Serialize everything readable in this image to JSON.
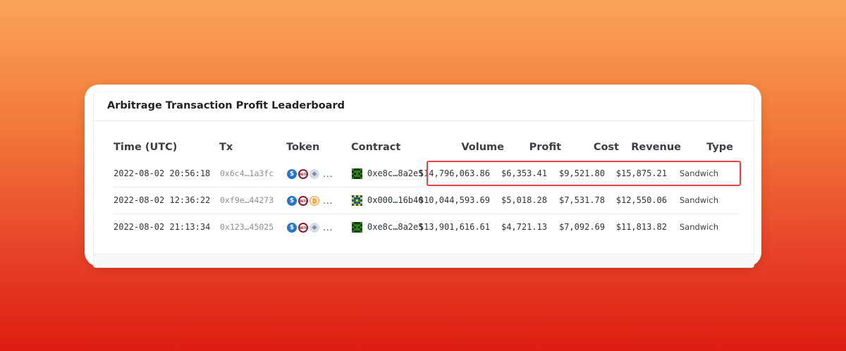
{
  "panel": {
    "title": "Arbitrage Transaction Profit Leaderboard"
  },
  "columns": {
    "time": "Time (UTC)",
    "tx": "Tx",
    "token": "Token",
    "contract": "Contract",
    "volume": "Volume",
    "profit": "Profit",
    "cost": "Cost",
    "revenue": "Revenue",
    "type": "Type"
  },
  "rows": [
    {
      "time": "2022-08-02 20:56:18",
      "tx": "0x6c4…1a3fc",
      "tokens": [
        "usdc-icon",
        "weth-icon",
        "eth-icon"
      ],
      "more": "...",
      "contract": "0xe8c…8a2e5",
      "volume": "$14,796,063.86",
      "profit": "$6,353.41",
      "cost": "$9,521.80",
      "revenue": "$15,875.21",
      "type": "Sandwich"
    },
    {
      "time": "2022-08-02 12:36:22",
      "tx": "0xf9e…44273",
      "tokens": [
        "usdc-icon",
        "weth-icon",
        "btc-icon"
      ],
      "more": "...",
      "contract": "0x000…16b40",
      "volume": "$10,044,593.69",
      "profit": "$5,018.28",
      "cost": "$7,531.78",
      "revenue": "$12,550.06",
      "type": "Sandwich"
    },
    {
      "time": "2022-08-02 21:13:34",
      "tx": "0x123…45025",
      "tokens": [
        "usdc-icon",
        "weth-icon",
        "eth-icon"
      ],
      "more": "...",
      "contract": "0xe8c…8a2e5",
      "volume": "$13,901,616.61",
      "profit": "$4,721.13",
      "cost": "$7,092.69",
      "revenue": "$11,813.82",
      "type": "Sandwich"
    }
  ],
  "token_glyphs": {
    "usdc": "$",
    "weth": "WETH",
    "eth": "◆",
    "btc": "₿"
  },
  "colors": {
    "highlight": "#e84343",
    "usdc": "#2775ca",
    "weth": "#8b1a2e"
  }
}
